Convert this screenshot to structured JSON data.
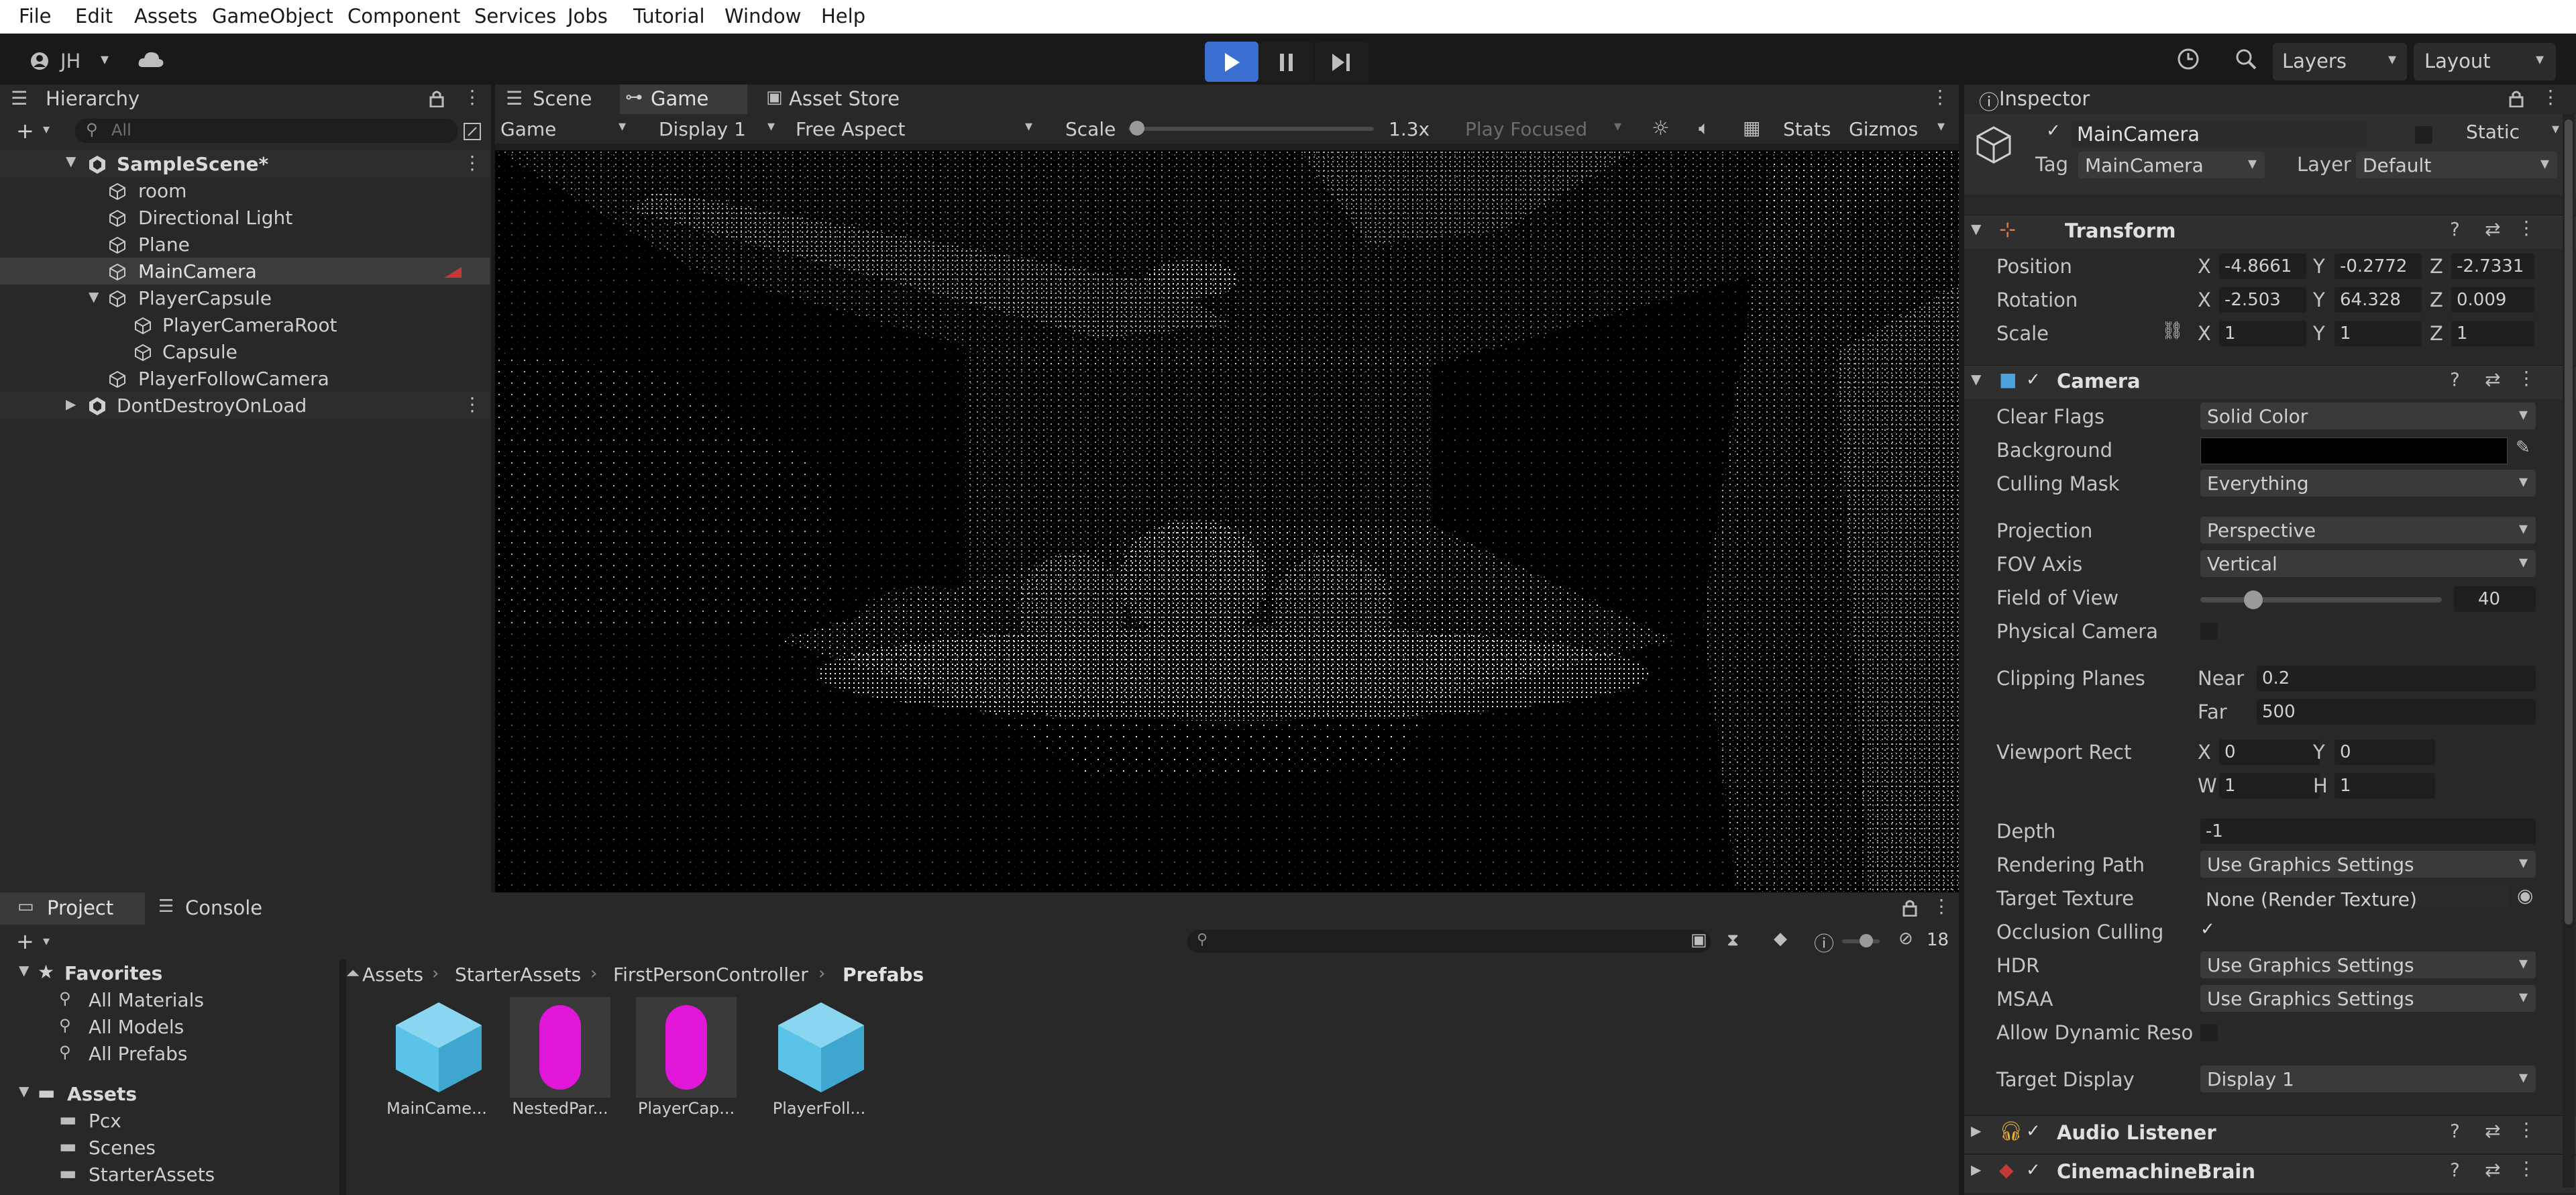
{
  "menu": [
    "File",
    "Edit",
    "Assets",
    "GameObject",
    "Component",
    "Services",
    "Jobs",
    "Tutorial",
    "Window",
    "Help"
  ],
  "toolbar": {
    "account": "JH",
    "layers_label": "Layers",
    "layout_label": "Layout"
  },
  "hierarchy": {
    "tab_label": "Hierarchy",
    "search_placeholder": "All",
    "scene": "SampleScene*",
    "items": [
      "room",
      "Directional Light",
      "Plane",
      "MainCamera",
      "PlayerCapsule",
      "PlayerCameraRoot",
      "Capsule",
      "PlayerFollowCamera"
    ],
    "dont_destroy": "DontDestroyOnLoad"
  },
  "view": {
    "tabs": [
      "Scene",
      "Game",
      "Asset Store"
    ],
    "game_mode": "Game",
    "display": "Display 1",
    "aspect": "Free Aspect",
    "scale_label": "Scale",
    "scale_value": "1.3x",
    "play_focused": "Play Focused",
    "stats": "Stats",
    "gizmos": "Gizmos"
  },
  "project": {
    "tabs": [
      "Project",
      "Console"
    ],
    "favorites_label": "Favorites",
    "favorites": [
      "All Materials",
      "All Models",
      "All Prefabs"
    ],
    "assets_label": "Assets",
    "folders": [
      "Pcx",
      "Scenes",
      "StarterAssets"
    ],
    "breadcrumb": [
      "Assets",
      "StarterAssets",
      "FirstPersonController",
      "Prefabs"
    ],
    "hidden_count": "18",
    "items": [
      {
        "name": "MainCame...",
        "kind": "cube"
      },
      {
        "name": "NestedPar...",
        "kind": "capsule"
      },
      {
        "name": "PlayerCap...",
        "kind": "capsule"
      },
      {
        "name": "PlayerFoll...",
        "kind": "cube"
      }
    ]
  },
  "inspector": {
    "tab_label": "Inspector",
    "object_name": "MainCamera",
    "static_label": "Static",
    "tag_label": "Tag",
    "tag_value": "MainCamera",
    "layer_label": "Layer",
    "layer_value": "Default",
    "transform": {
      "title": "Transform",
      "position_label": "Position",
      "rotation_label": "Rotation",
      "scale_label": "Scale",
      "position": {
        "x": "-4.8661",
        "y": "-0.2772",
        "z": "-2.7331"
      },
      "rotation": {
        "x": "-2.503",
        "y": "64.328",
        "z": "0.009"
      },
      "scale": {
        "x": "1",
        "y": "1",
        "z": "1"
      }
    },
    "camera": {
      "title": "Camera",
      "clear_flags_label": "Clear Flags",
      "clear_flags": "Solid Color",
      "background_label": "Background",
      "culling_mask_label": "Culling Mask",
      "culling_mask": "Everything",
      "projection_label": "Projection",
      "projection": "Perspective",
      "fov_axis_label": "FOV Axis",
      "fov_axis": "Vertical",
      "fov_label": "Field of View",
      "fov": "40",
      "fov_fraction": 0.22,
      "physical_label": "Physical Camera",
      "clipping_label": "Clipping Planes",
      "near_label": "Near",
      "near": "0.2",
      "far_label": "Far",
      "far": "500",
      "viewport_label": "Viewport Rect",
      "vp": {
        "x": "0",
        "y": "0",
        "w": "1",
        "h": "1"
      },
      "depth_label": "Depth",
      "depth": "-1",
      "rendering_path_label": "Rendering Path",
      "rendering_path": "Use Graphics Settings",
      "target_texture_label": "Target Texture",
      "target_texture": "None (Render Texture)",
      "occlusion_label": "Occlusion Culling",
      "hdr_label": "HDR",
      "hdr": "Use Graphics Settings",
      "msaa_label": "MSAA",
      "msaa": "Use Graphics Settings",
      "dynamic_label": "Allow Dynamic Reso",
      "target_display_label": "Target Display",
      "target_display": "Display 1"
    },
    "audio_listener": "Audio Listener",
    "cinemachine_brain": "CinemachineBrain"
  },
  "colors": {
    "play_blue": "#3a6fd1",
    "cube_blue": "#5cc3e8",
    "capsule_magenta": "#e016d8",
    "error_red": "#c43838"
  }
}
